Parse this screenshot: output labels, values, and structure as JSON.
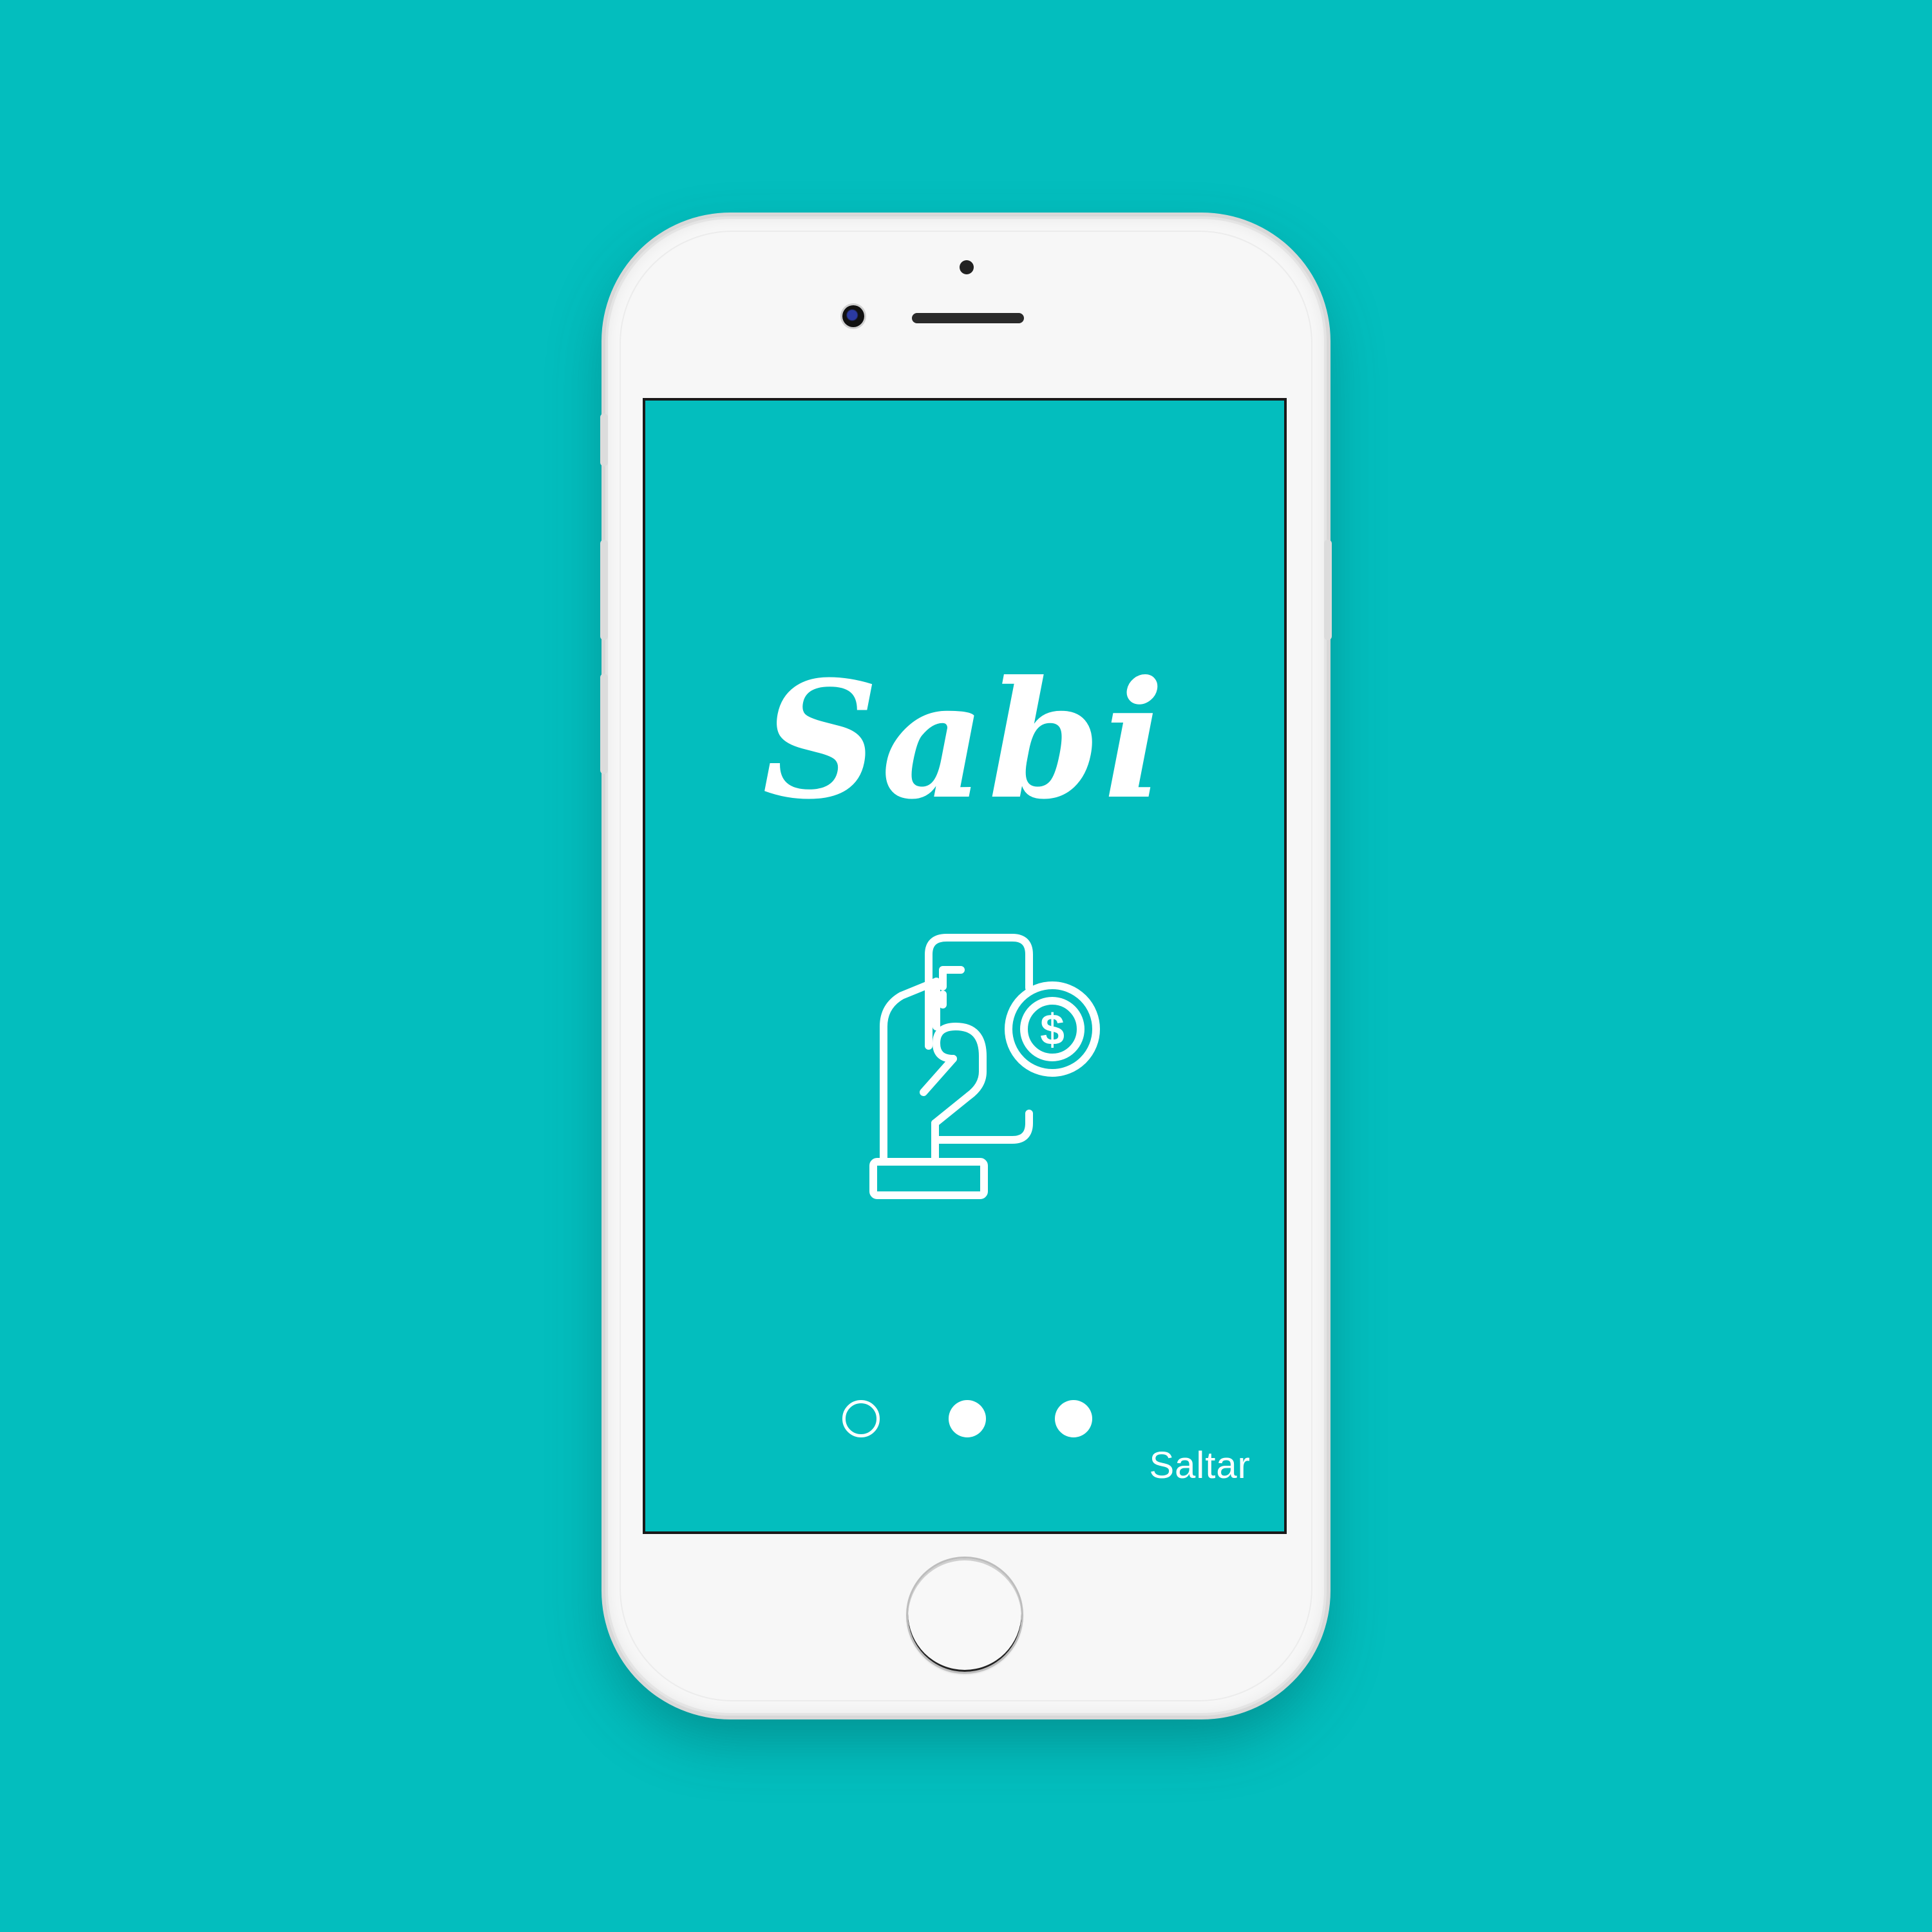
{
  "app": {
    "brand_name": "Sabi",
    "illustration_icon": "hand-holding-phone-dollar-icon"
  },
  "onboarding": {
    "total_pages": 3,
    "current_page": 1,
    "skip_label": "Saltar"
  },
  "colors": {
    "background": "#03BEBE",
    "screen": "#03BEBE",
    "foreground": "#FFFFFF",
    "device_body": "#F7F7F7"
  }
}
